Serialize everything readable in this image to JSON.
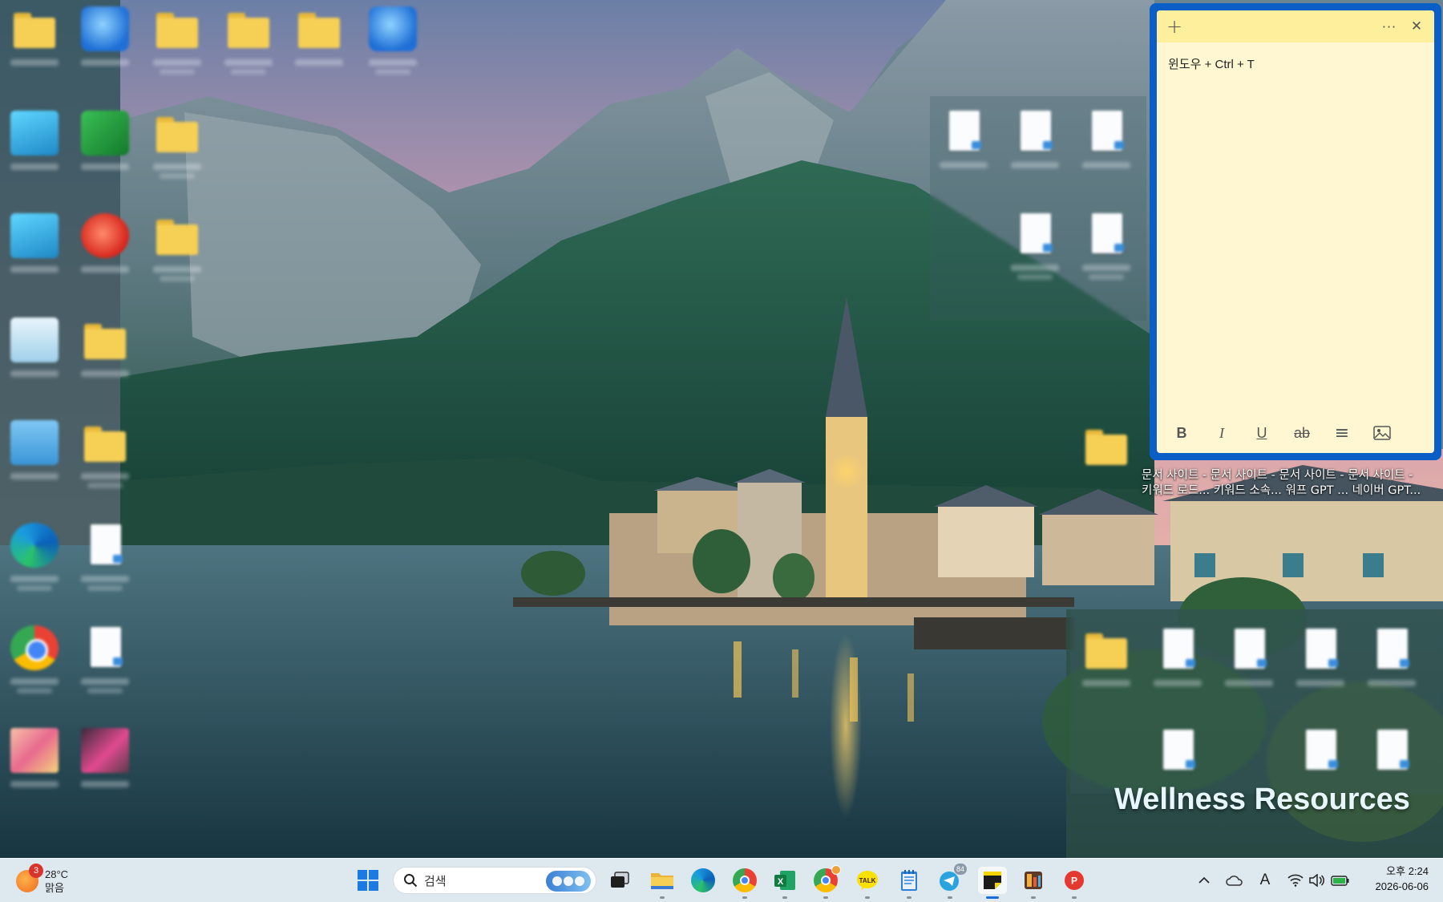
{
  "sticky_note": {
    "text": "윈도우 + Ctrl + T",
    "add_label": "+",
    "menu_label": "···",
    "close_label": "✕",
    "toolbar": {
      "bold": "B",
      "italic": "I",
      "underline": "U",
      "strike": "ab",
      "list": "≡",
      "image": "🖼"
    }
  },
  "desktop_files": {
    "line1": "문서 사이트 - 문서 사이트 - 문서 사이트 - 문서 사이트 -",
    "line2": "키워드 로드... 키워드 소속...  워프 GPT ...   네이버 GPT..."
  },
  "watermark": "Wellness Resources",
  "taskbar": {
    "weather": {
      "badge": "3",
      "temp": "28°C",
      "condition": "맑음"
    },
    "search_placeholder": "검색",
    "telegram_badge": "84",
    "clock": {
      "time": "오후 2:24",
      "date": "2026-06-06"
    },
    "ime_label": "A"
  },
  "colors": {
    "sticky_border": "#0a5ec6",
    "sticky_body": "#fff7d1",
    "sticky_titlebar": "#fdef9c",
    "taskbar": "#e6eef6"
  },
  "icons": {
    "taskbar": [
      "windows-start-icon",
      "search-icon",
      "task-view-icon",
      "file-explorer-icon",
      "edge-icon",
      "chrome-icon",
      "excel-icon",
      "chrome-alt-icon",
      "kakaotalk-icon",
      "notepad-icon",
      "telegram-icon",
      "sticky-notes-icon",
      "app-icon",
      "pdf-icon"
    ],
    "tray": [
      "chevron-up-icon",
      "onedrive-icon",
      "ime-icon",
      "wifi-icon",
      "volume-icon",
      "battery-icon"
    ]
  }
}
